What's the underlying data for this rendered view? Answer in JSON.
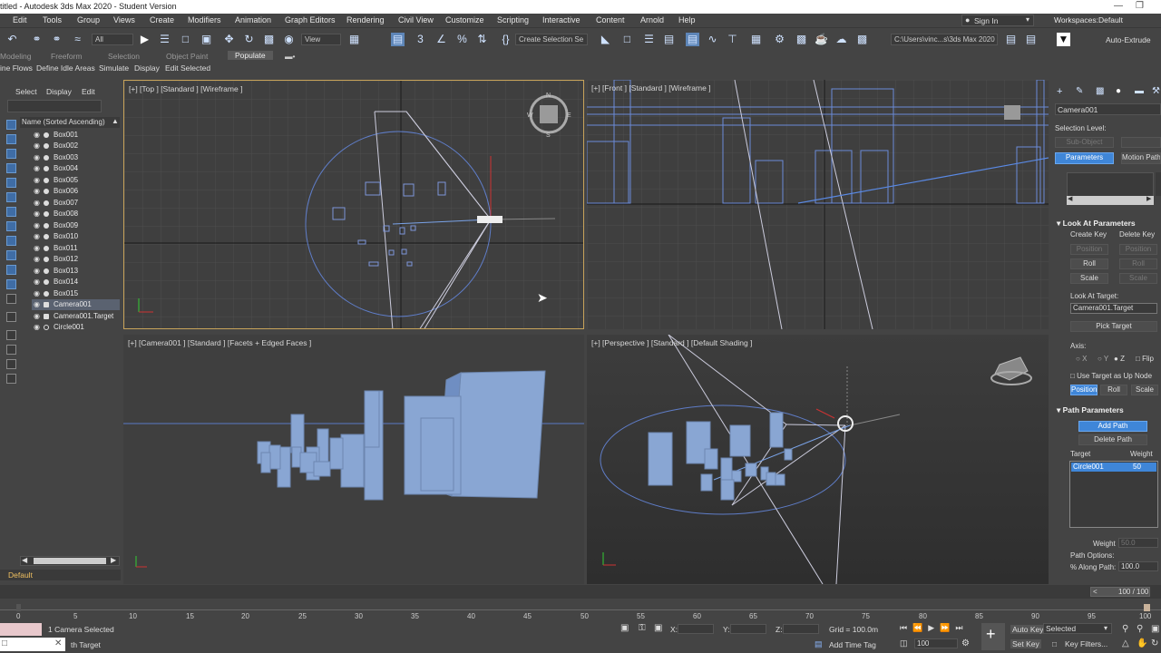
{
  "window": {
    "title": "titled - Autodesk 3ds Max 2020 - Student Version"
  },
  "menu": [
    "Edit",
    "Tools",
    "Group",
    "Views",
    "Create",
    "Modifiers",
    "Animation",
    "Graph Editors",
    "Rendering",
    "Civil View",
    "Customize",
    "Scripting",
    "Interactive",
    "Content",
    "Arnold",
    "Help"
  ],
  "account": {
    "sign_in": "Sign In",
    "workspaces_label": "Workspaces:",
    "workspace": "Default"
  },
  "toolbar": {
    "filter": "All",
    "ref_coord": "View",
    "selection_set": "Create Selection Se",
    "path": "C:\\Users\\vinc...s\\3ds Max 2020",
    "auto_extrude": "Auto-Extrude"
  },
  "ribbon": {
    "tabs": [
      "Modeling",
      "Freeform",
      "Selection",
      "Object Paint",
      "Populate"
    ],
    "active_tab": "Populate",
    "items": [
      "ine Flows",
      "Define Idle Areas",
      "Simulate",
      "Display",
      "Edit Selected"
    ]
  },
  "scene_explorer": {
    "menu": [
      "Select",
      "Display",
      "Edit"
    ],
    "header": "Name (Sorted Ascending)",
    "items": [
      "Box001",
      "Box002",
      "Box003",
      "Box004",
      "Box005",
      "Box006",
      "Box007",
      "Box008",
      "Box009",
      "Box010",
      "Box011",
      "Box012",
      "Box013",
      "Box014",
      "Box015",
      "Camera001",
      "Camera001.Target",
      "Circle001"
    ],
    "selected": "Camera001",
    "layer": "Default"
  },
  "viewports": {
    "top": "[+] [Top ] [Standard ] [Wireframe ]",
    "front": "[+] [Front ] [Standard ] [Wireframe ]",
    "camera": "[+] [Camera001 ] [Standard ] [Facets + Edged Faces ]",
    "perspective": "[+] [Perspective ] [Standard ] [Default Shading ]"
  },
  "command_panel": {
    "object_name": "Camera001",
    "selection_level": "Selection Level:",
    "sub_object": "Sub-Object",
    "tabs": [
      "Parameters",
      "Motion Paths"
    ],
    "look_at": {
      "title": "Look At Parameters",
      "create_key": "Create Key",
      "delete_key": "Delete Key",
      "position": "Position",
      "roll": "Roll",
      "scale": "Scale",
      "look_at_target_label": "Look At Target:",
      "look_at_target": "Camera001.Target",
      "pick_target": "Pick Target",
      "axis_label": "Axis:",
      "axis": [
        "X",
        "Y",
        "Z"
      ],
      "flip": "Flip",
      "use_target_up": "Use Target as Up Node",
      "buttons": [
        "Position",
        "Roll",
        "Scale"
      ]
    },
    "path_params": {
      "title": "Path Parameters",
      "add_path": "Add Path",
      "delete_path": "Delete Path",
      "target_col": "Target",
      "weight_col": "Weight",
      "target": "Circle001",
      "weight": "50",
      "weight_label": "Weight",
      "weight_value": "50.0",
      "path_options": "Path Options:",
      "along_path_label": "% Along Path:",
      "along_path": "100.0"
    }
  },
  "timeline": {
    "frame": "100 / 100",
    "ticks": [
      "0",
      "5",
      "10",
      "15",
      "20",
      "25",
      "30",
      "35",
      "40",
      "45",
      "50",
      "55",
      "60",
      "65",
      "70",
      "75",
      "80",
      "85",
      "90",
      "95",
      "100"
    ]
  },
  "status": {
    "selected": "1 Camera Selected",
    "hint": "th Target",
    "x_label": "X:",
    "y_label": "Y:",
    "z_label": "Z:",
    "grid": "Grid = 100.0m",
    "add_time_tag": "Add Time Tag",
    "auto_key": "Auto Key",
    "set_key": "Set Key",
    "selected_dropdown": "Selected",
    "key_filters": "Key Filters...",
    "frame": "100"
  }
}
